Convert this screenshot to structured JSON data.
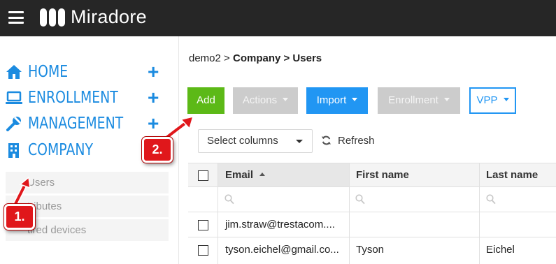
{
  "app": {
    "name": "Miradore"
  },
  "icons": {
    "menu": "hamburger-icon",
    "logo": "miradore-logo-icon",
    "home": "home-icon",
    "enrollment": "laptop-icon",
    "management": "wrench-icon",
    "company": "building-icon",
    "refresh": "refresh-icon",
    "search": "search-icon"
  },
  "colors": {
    "accent": "#1b8be0",
    "add": "#5cb917",
    "primary": "#2196f3",
    "disabled": "#cccccc",
    "callout": "#e0171b"
  },
  "sidebar": {
    "nav": [
      {
        "label": "HOME"
      },
      {
        "label": "ENROLLMENT"
      },
      {
        "label": "MANAGEMENT"
      },
      {
        "label": "COMPANY"
      }
    ],
    "plus": "+",
    "sub_items": [
      {
        "label": "Users"
      },
      {
        "label": "tributes"
      },
      {
        "label": "tired devices"
      }
    ]
  },
  "callouts": {
    "one": "1.",
    "two": "2."
  },
  "breadcrumb": {
    "root": "demo2",
    "sep": ">",
    "path": "Company > Users"
  },
  "toolbar": {
    "add": "Add",
    "actions": "Actions",
    "import": "Import",
    "enrollment": "Enrollment",
    "vpp": "VPP"
  },
  "filters": {
    "select_columns": "Select columns",
    "refresh": "Refresh"
  },
  "table": {
    "columns": [
      "Email",
      "First name",
      "Last name"
    ],
    "rows": [
      {
        "email": "jim.straw@trestacom....",
        "first": "",
        "last": ""
      },
      {
        "email": "tyson.eichel@gmail.co...",
        "first": "Tyson",
        "last": "Eichel"
      }
    ]
  }
}
